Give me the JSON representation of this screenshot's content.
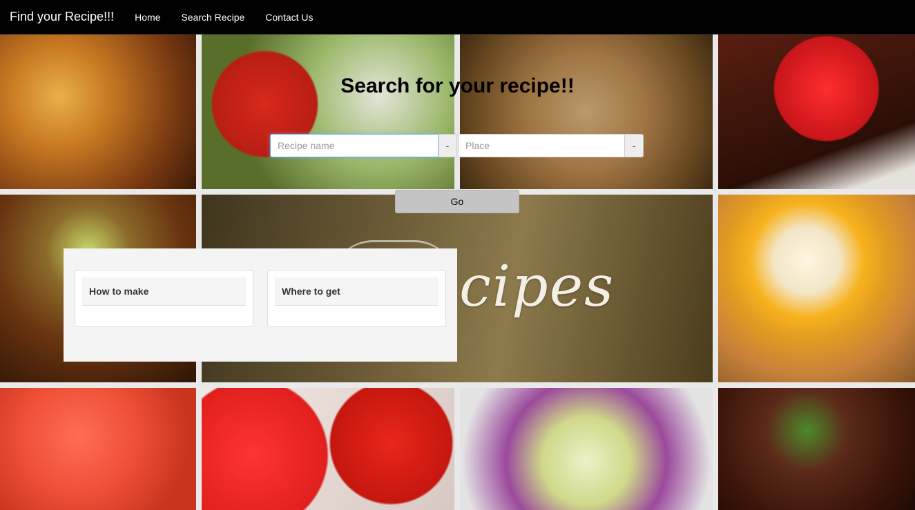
{
  "navbar": {
    "brand": "Find your Recipe!!!",
    "links": [
      "Home",
      "Search Recipe",
      "Contact Us"
    ]
  },
  "background": {
    "banner_text": "cipes"
  },
  "search": {
    "heading": "Search for your recipe!!",
    "recipe_placeholder": "Recipe name",
    "recipe_addon": "-",
    "place_placeholder": "Place",
    "place_addon": "-",
    "go_label": "Go"
  },
  "results": {
    "panels": [
      {
        "title": "How to make"
      },
      {
        "title": "Where to get"
      }
    ]
  },
  "colors": {
    "navbar_bg": "#000000",
    "input_focus": "#66afe9",
    "go_button_bg": "#c4c4c4",
    "results_bg": "#f4f4f4"
  }
}
